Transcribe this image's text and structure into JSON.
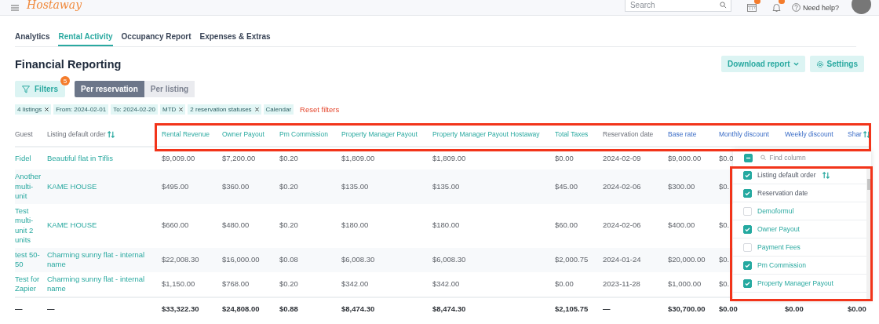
{
  "topbar": {
    "logo": "Hostaway",
    "search": {
      "placeholder": "Search"
    },
    "help": "Need help?"
  },
  "tabs": [
    {
      "label": "Analytics",
      "selected": false
    },
    {
      "label": "Rental Activity",
      "selected": true
    },
    {
      "label": "Occupancy Report",
      "selected": false
    },
    {
      "label": "Expenses & Extras",
      "selected": false
    }
  ],
  "title": "Financial Reporting",
  "actions": {
    "download": "Download report",
    "settings": "Settings"
  },
  "filters_button": {
    "label": "Filters",
    "badge": "5"
  },
  "view_toggle": [
    {
      "label": "Per reservation",
      "selected": true
    },
    {
      "label": "Per listing",
      "selected": false
    }
  ],
  "chips": [
    {
      "label": "4 listings",
      "removable": true
    },
    {
      "label": "From: 2024-02-01",
      "removable": false
    },
    {
      "label": "To: 2024-02-20",
      "removable": false
    },
    {
      "label": "MTD",
      "removable": true
    },
    {
      "label": "2 reservation statuses",
      "removable": true
    },
    {
      "label": "Calendar",
      "removable": false
    }
  ],
  "reset": "Reset filters",
  "table": {
    "columns": [
      {
        "label": "Guest",
        "kind": "link",
        "sortable": false
      },
      {
        "label": "Listing default order",
        "kind": "link",
        "sortable": true
      },
      {
        "label": "Rental Revenue",
        "kind": "financial",
        "sortable": false
      },
      {
        "label": "Owner Payout",
        "kind": "financial",
        "sortable": false
      },
      {
        "label": "Pm Commission",
        "kind": "financial",
        "sortable": false
      },
      {
        "label": "Property Manager Payout",
        "kind": "financial",
        "sortable": false
      },
      {
        "label": "Property Manager Payout Hostaway",
        "kind": "financial",
        "sortable": false
      },
      {
        "label": "Total Taxes",
        "kind": "financial",
        "sortable": false
      },
      {
        "label": "Reservation date",
        "kind": "standard",
        "sortable": false
      },
      {
        "label": "Base rate",
        "kind": "custom",
        "sortable": false
      },
      {
        "label": "Monthly discount",
        "kind": "custom",
        "sortable": false
      },
      {
        "label": "Weekly discount",
        "kind": "custom",
        "sortable": false
      },
      {
        "label": "Shar",
        "kind": "custom",
        "sortable": true
      }
    ],
    "rows": [
      {
        "cells": [
          "Fidel",
          "Beautiful flat in Tiflis",
          "$9,009.00",
          "$7,200.00",
          "$0.20",
          "$1,809.00",
          "$1,809.00",
          "$0.00",
          "2024-02-09",
          "$9,000.00",
          "$0.0"
        ]
      },
      {
        "cells": [
          "Another multi-unit",
          "KAME HOUSE",
          "$495.00",
          "$360.00",
          "$0.20",
          "$135.00",
          "$135.00",
          "$45.00",
          "2024-02-06",
          "$300.00",
          "$0."
        ]
      },
      {
        "cells": [
          "Test multi-unit 2 units",
          "KAME HOUSE",
          "$660.00",
          "$480.00",
          "$0.20",
          "$180.00",
          "$180.00",
          "$60.00",
          "2024-02-06",
          "$400.00",
          "$0."
        ]
      },
      {
        "cells": [
          "test 50-50",
          "Charming sunny flat - internal name",
          "$22,008.30",
          "$16,000.00",
          "$0.08",
          "$6,008.30",
          "$6,008.30",
          "$2,000.75",
          "2024-01-24",
          "$20,000.00",
          "$0."
        ]
      },
      {
        "cells": [
          "Test for Zapier",
          "Charming sunny flat - internal name",
          "$1,150.00",
          "$768.00",
          "$0.20",
          "$342.00",
          "$342.00",
          "$0.00",
          "2023-11-28",
          "$1,000.00",
          "$0."
        ]
      }
    ],
    "totals": [
      "—",
      "—",
      "$33,322.30",
      "$24,808.00",
      "$0.88",
      "$8,474.30",
      "$8,474.30",
      "$2,105.75",
      "—",
      "$30,700.00",
      "$0.00",
      "$0.00",
      "$0.00"
    ]
  },
  "column_picker": {
    "select_all": {
      "indeterminate": true
    },
    "placeholder": "Find column",
    "items": [
      {
        "label": "Listing default order",
        "kind": "link",
        "checked": true,
        "sortable": true
      },
      {
        "label": "Reservation date",
        "kind": "standard",
        "checked": true,
        "sortable": false
      },
      {
        "label": "Demoformul",
        "kind": "financial",
        "checked": false,
        "sortable": false
      },
      {
        "label": "Owner Payout",
        "kind": "financial",
        "checked": true,
        "sortable": false
      },
      {
        "label": "Payment Fees",
        "kind": "financial",
        "checked": false,
        "sortable": false
      },
      {
        "label": "Pm Commission",
        "kind": "financial",
        "checked": true,
        "sortable": false
      },
      {
        "label": "Property Manager Payout",
        "kind": "financial",
        "checked": true,
        "sortable": false
      }
    ]
  }
}
